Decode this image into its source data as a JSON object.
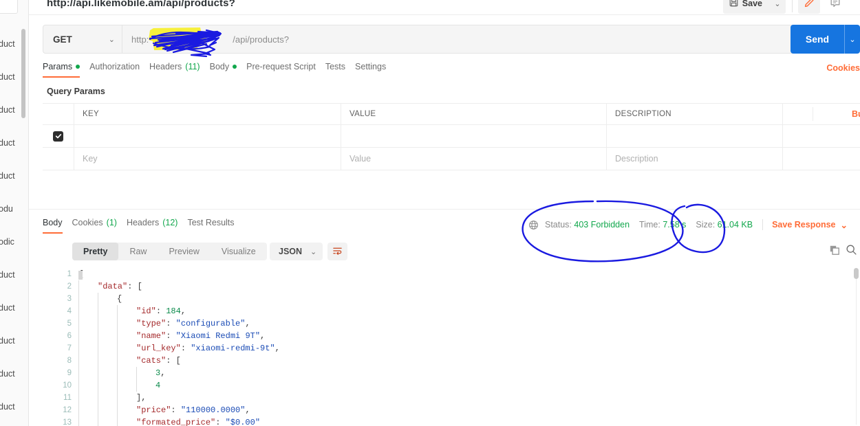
{
  "sidebar": {
    "menu_icon": "ellipsis-icon",
    "items": [
      {
        "label": "duct"
      },
      {
        "label": "duct"
      },
      {
        "label": "duct"
      },
      {
        "label": "duct"
      },
      {
        "label": "duct"
      },
      {
        "label": "odu"
      },
      {
        "label": "odic"
      },
      {
        "label": "duct"
      },
      {
        "label": "duct"
      },
      {
        "label": "duct"
      },
      {
        "label": "duct"
      },
      {
        "label": "duct"
      }
    ]
  },
  "header": {
    "request_title": "http://api.likemobile.am/api/products?",
    "save_label": "Save",
    "save_caret": "⌄",
    "edit_icon": "pencil-icon",
    "comment_icon": "comment-icon"
  },
  "url_bar": {
    "method": "GET",
    "method_caret": "⌄",
    "url_prefix": "http:",
    "url_suffix": "/api/products?",
    "send_label": "Send",
    "send_caret": "⌄"
  },
  "request_tabs": [
    {
      "label": "Params",
      "indicator": "dot",
      "active": true
    },
    {
      "label": "Authorization",
      "indicator": "",
      "active": false
    },
    {
      "label": "Headers",
      "count": "(11)",
      "active": false
    },
    {
      "label": "Body",
      "indicator": "dot",
      "active": false
    },
    {
      "label": "Pre-request Script",
      "indicator": "",
      "active": false
    },
    {
      "label": "Tests",
      "indicator": "",
      "active": false
    },
    {
      "label": "Settings",
      "indicator": "",
      "active": false
    }
  ],
  "cookies_link": "Cookies",
  "query_params": {
    "section_label": "Query Params",
    "columns": [
      "KEY",
      "VALUE",
      "DESCRIPTION"
    ],
    "rows": [
      {
        "checked": true,
        "key": "",
        "value": "",
        "description": ""
      }
    ],
    "placeholder_row": {
      "key": "Key",
      "value": "Value",
      "description": "Description"
    },
    "options_icon": "ellipsis-icon",
    "bulk_edit": "Bulk Edit"
  },
  "response": {
    "tabs": [
      {
        "label": "Body",
        "active": true
      },
      {
        "label": "Cookies",
        "count": "(1)",
        "active": false
      },
      {
        "label": "Headers",
        "count": "(12)",
        "active": false
      },
      {
        "label": "Test Results",
        "active": false
      }
    ],
    "status": {
      "globe_icon": "globe-icon",
      "status_label": "Status:",
      "status_value": "403 Forbidden",
      "time_label": "Time:",
      "time_value": "7.58 s",
      "size_label": "Size:",
      "size_value": "61.04 KB",
      "save_response": "Save Response",
      "save_caret": "⌄"
    },
    "view_modes": [
      {
        "label": "Pretty",
        "active": true
      },
      {
        "label": "Raw",
        "active": false
      },
      {
        "label": "Preview",
        "active": false
      },
      {
        "label": "Visualize",
        "active": false
      }
    ],
    "format": "JSON",
    "format_caret": "⌄",
    "wrap_icon": "word-wrap-icon",
    "copy_icon": "copy-icon",
    "search_icon": "search-icon"
  },
  "code_lines": [
    {
      "n": "1",
      "tokens": [
        {
          "t": "{",
          "c": "k-pun"
        }
      ]
    },
    {
      "n": "2",
      "tokens": [
        {
          "t": "    ",
          "c": "indent-guide"
        },
        {
          "t": "\"data\"",
          "c": "k-key"
        },
        {
          "t": ": [",
          "c": "k-pun"
        }
      ]
    },
    {
      "n": "3",
      "tokens": [
        {
          "t": "        ",
          "c": "indent-guide"
        },
        {
          "t": "{",
          "c": "k-pun"
        }
      ]
    },
    {
      "n": "4",
      "tokens": [
        {
          "t": "            ",
          "c": "indent-guide"
        },
        {
          "t": "\"id\"",
          "c": "k-key"
        },
        {
          "t": ": ",
          "c": "k-pun"
        },
        {
          "t": "184",
          "c": "k-num"
        },
        {
          "t": ",",
          "c": "k-pun"
        }
      ]
    },
    {
      "n": "5",
      "tokens": [
        {
          "t": "            ",
          "c": "indent-guide"
        },
        {
          "t": "\"type\"",
          "c": "k-key"
        },
        {
          "t": ": ",
          "c": "k-pun"
        },
        {
          "t": "\"configurable\"",
          "c": "k-str"
        },
        {
          "t": ",",
          "c": "k-pun"
        }
      ]
    },
    {
      "n": "6",
      "tokens": [
        {
          "t": "            ",
          "c": "indent-guide"
        },
        {
          "t": "\"name\"",
          "c": "k-key"
        },
        {
          "t": ": ",
          "c": "k-pun"
        },
        {
          "t": "\"Xiaomi Redmi 9T\"",
          "c": "k-str"
        },
        {
          "t": ",",
          "c": "k-pun"
        }
      ]
    },
    {
      "n": "7",
      "tokens": [
        {
          "t": "            ",
          "c": "indent-guide"
        },
        {
          "t": "\"url_key\"",
          "c": "k-key"
        },
        {
          "t": ": ",
          "c": "k-pun"
        },
        {
          "t": "\"xiaomi-redmi-9t\"",
          "c": "k-str"
        },
        {
          "t": ",",
          "c": "k-pun"
        }
      ]
    },
    {
      "n": "8",
      "tokens": [
        {
          "t": "            ",
          "c": "indent-guide"
        },
        {
          "t": "\"cats\"",
          "c": "k-key"
        },
        {
          "t": ": [",
          "c": "k-pun"
        }
      ]
    },
    {
      "n": "9",
      "tokens": [
        {
          "t": "                ",
          "c": "indent-guide"
        },
        {
          "t": "3",
          "c": "k-num"
        },
        {
          "t": ",",
          "c": "k-pun"
        }
      ]
    },
    {
      "n": "10",
      "tokens": [
        {
          "t": "                ",
          "c": "indent-guide"
        },
        {
          "t": "4",
          "c": "k-num"
        }
      ]
    },
    {
      "n": "11",
      "tokens": [
        {
          "t": "            ",
          "c": "indent-guide"
        },
        {
          "t": "],",
          "c": "k-pun"
        }
      ]
    },
    {
      "n": "12",
      "tokens": [
        {
          "t": "            ",
          "c": "indent-guide"
        },
        {
          "t": "\"price\"",
          "c": "k-key"
        },
        {
          "t": ": ",
          "c": "k-pun"
        },
        {
          "t": "\"110000.0000\"",
          "c": "k-str"
        },
        {
          "t": ",",
          "c": "k-pun"
        }
      ]
    },
    {
      "n": "13",
      "tokens": [
        {
          "t": "            ",
          "c": "indent-guide"
        },
        {
          "t": "\"formated_price\"",
          "c": "k-key"
        },
        {
          "t": ": ",
          "c": "k-pun"
        },
        {
          "t": "\"$0.00\"",
          "c": "k-str"
        }
      ]
    }
  ],
  "annotations": {
    "highlight_color": "#f7ef32",
    "ink_color": "#1a1ae0",
    "marks": [
      "url-scribble",
      "status-circle",
      "time-circle"
    ]
  }
}
